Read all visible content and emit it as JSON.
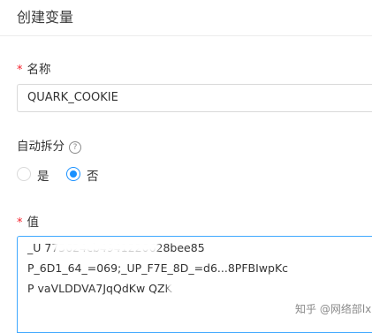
{
  "dialog": {
    "title": "创建变量"
  },
  "form": {
    "name_label": "名称",
    "name_value": "QUARK_COOKIE",
    "auto_split_label": "自动拆分",
    "help_glyph": "?",
    "radio_yes": "是",
    "radio_no": "否",
    "selected_option": "否",
    "value_label": "值",
    "value_lines": [
      "_U          775624cb4941220628bee85",
      "P_6D1_64_=069;_UP_F7E_8D_=d6...8PFBIwpKc",
      "P                    vaVLDDVA7JqQdKw      QZK",
      "                                                  ",
      "                                             "
    ]
  },
  "watermark": {
    "text": "知乎 @网络部lx"
  },
  "colors": {
    "accent": "#1890ff",
    "required": "#f5222d",
    "border": "#d9d9d9"
  }
}
